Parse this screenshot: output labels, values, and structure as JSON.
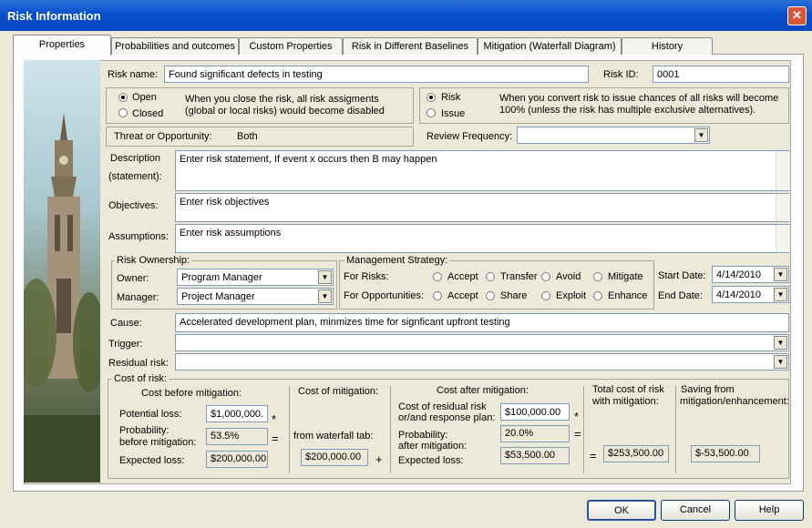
{
  "window": {
    "title": "Risk Information",
    "close_glyph": "✕"
  },
  "tabs": [
    "Properties",
    "Probabilities and outcomes",
    "Custom Properties",
    "Risk in Different Baselines",
    "Mitigation (Waterfall Diagram)",
    "History"
  ],
  "risk_name": {
    "label": "Risk name:",
    "value": "Found significant defects in testing"
  },
  "risk_id": {
    "label": "Risk ID:",
    "value": "0001"
  },
  "status": {
    "open": "Open",
    "closed": "Closed",
    "note": "When you close the risk, all risk assigments (global or local risks) would become disabled",
    "selected": "Open"
  },
  "kind": {
    "risk": "Risk",
    "issue": "Issue",
    "note": "When you convert risk to issue chances of all risks will become 100% (unless the risk has multiple exclusive alternatives).",
    "selected": "Risk"
  },
  "threat": {
    "label": "Threat or Opportunity:",
    "value": "Both"
  },
  "review": {
    "label": "Review Frequency:",
    "value": ""
  },
  "description": {
    "label1": "Description",
    "label2": "(statement):",
    "value": "Enter risk statement, If event x occurs then B may happen"
  },
  "objectives": {
    "label": "Objectives:",
    "value": "Enter risk objectives"
  },
  "assumptions": {
    "label": "Assumptions:",
    "value": "Enter risk assumptions"
  },
  "ownership": {
    "title": "Risk Ownership:",
    "owner_label": "Owner:",
    "owner": "Program Manager",
    "manager_label": "Manager:",
    "manager": "Project Manager"
  },
  "strategy": {
    "title": "Management Strategy:",
    "risks_label": "For Risks:",
    "opps_label": "For Opportunities:",
    "risk_options": [
      "Accept",
      "Transfer",
      "Avoid",
      "Mitigate"
    ],
    "opp_options": [
      "Accept",
      "Share",
      "Exploit",
      "Enhance"
    ]
  },
  "dates": {
    "start_label": "Start Date:",
    "start": "4/14/2010",
    "end_label": "End Date:",
    "end": "4/14/2010"
  },
  "cause": {
    "label": "Cause:",
    "value": "Accelerated development plan, minmizes time for signficant upfront testing"
  },
  "trigger": {
    "label": "Trigger:",
    "value": ""
  },
  "residual": {
    "label": "Residual risk:",
    "value": ""
  },
  "cost": {
    "title": "Cost of risk:",
    "before_title": "Cost before mitigation:",
    "potential_label": "Potential loss:",
    "potential": "$1,000,000.",
    "prob_label1": "Probability:",
    "prob_label2": "before mitigation:",
    "prob": "53.5%",
    "expected_label": "Expected loss:",
    "expected": "$200,000.00",
    "mit_title": "Cost of mitigation:",
    "mit_from": "from waterfall tab:",
    "mit_value": "$200,000.00",
    "after_title": "Cost after mitigation:",
    "resid_label1": "Cost of residual risk",
    "resid_label2": "or/and response plan:",
    "resid_value": "$100,000.00",
    "after_prob_label1": "Probability:",
    "after_prob_label2": "after mitigation:",
    "after_prob": "20.0%",
    "after_expected_label": "Expected loss:",
    "after_expected": "$53,500.00",
    "total_label1": "Total cost of risk",
    "total_label2": "with mitigation:",
    "total": "$253,500.00",
    "saving_label1": "Saving from",
    "saving_label2": "mitigation/enhancement:",
    "saving": "$-53,500.00",
    "op_times": "*",
    "op_equals": "=",
    "op_plus": "+"
  },
  "buttons": {
    "ok": "OK",
    "cancel": "Cancel",
    "help": "Help"
  },
  "dropdown_glyph": "▼",
  "scroll_up": "▲"
}
